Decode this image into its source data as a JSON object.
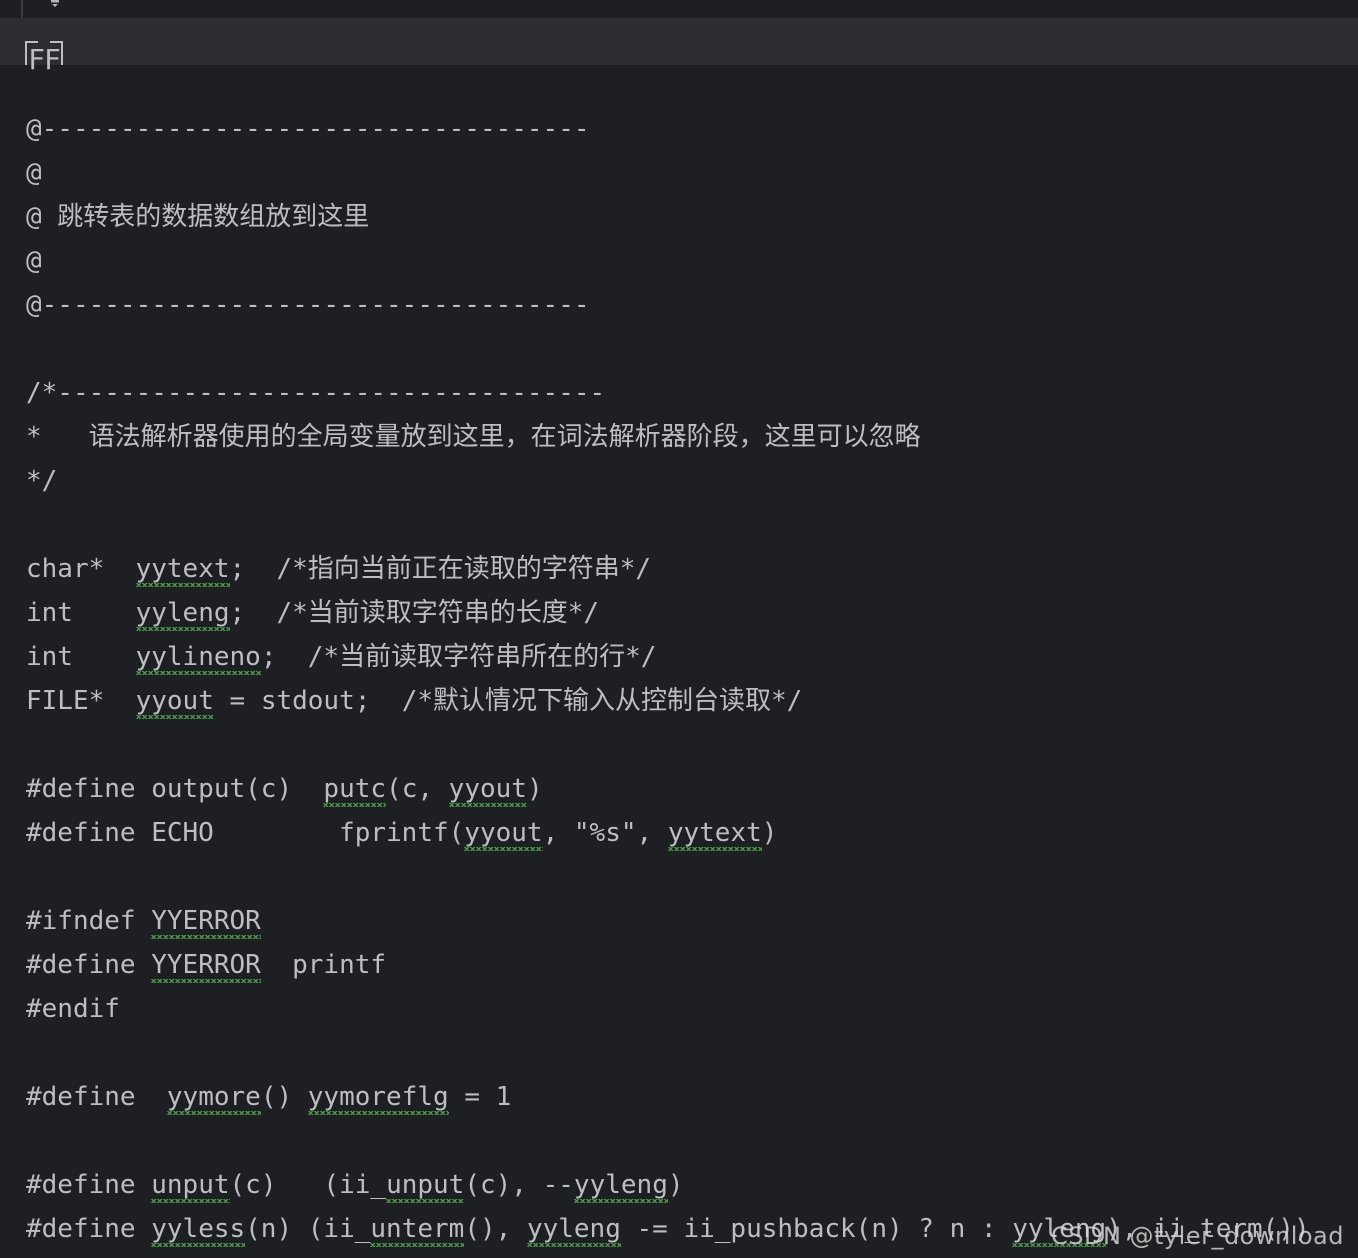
{
  "editor": {
    "background_color": "#1e1f22",
    "caret_row_color": "#2b2d30",
    "text_color": "#bcbec4",
    "gutter_rule_color": "#393b40",
    "spellcheck_squiggle_color": "#4e9a4e"
  },
  "intention_bulb": {
    "icon": "lightbulb-icon"
  },
  "fold_badge": {
    "label": "FF"
  },
  "code": {
    "lines": [
      {
        "id": "l01",
        "text": "@-----------------------------------",
        "cjk": false
      },
      {
        "id": "l02",
        "text": "@",
        "cjk": false
      },
      {
        "id": "l03",
        "text": "@ 跳转表的数据数组放到这里",
        "cjk": true
      },
      {
        "id": "l04",
        "text": "@",
        "cjk": false
      },
      {
        "id": "l05",
        "text": "@-----------------------------------",
        "cjk": false
      },
      {
        "id": "l06",
        "text": "",
        "cjk": false
      },
      {
        "id": "l07",
        "text": "/*-----------------------------------",
        "cjk": false
      },
      {
        "id": "l08",
        "text": "*   语法解析器使用的全局变量放到这里，在词法解析器阶段，这里可以忽略",
        "cjk": true
      },
      {
        "id": "l09",
        "text": "*/",
        "cjk": false
      },
      {
        "id": "l10",
        "text": "",
        "cjk": false
      },
      {
        "id": "l11",
        "text": "char*  yytext;  /*指向当前正在读取的字符串*/",
        "cjk": true
      },
      {
        "id": "l12",
        "text": "int    yyleng;  /*当前读取字符串的长度*/",
        "cjk": true
      },
      {
        "id": "l13",
        "text": "int    yylineno;  /*当前读取字符串所在的行*/",
        "cjk": true
      },
      {
        "id": "l14",
        "text": "FILE*  yyout = stdout;  /*默认情况下输入从控制台读取*/",
        "cjk": true
      },
      {
        "id": "l15",
        "text": "",
        "cjk": false
      },
      {
        "id": "l16",
        "text": "#define output(c)  putc(c, yyout)",
        "cjk": false
      },
      {
        "id": "l17",
        "text": "#define ECHO        fprintf(yyout, \"%s\", yytext)",
        "cjk": false
      },
      {
        "id": "l18",
        "text": "",
        "cjk": false
      },
      {
        "id": "l19",
        "text": "#ifndef YYERROR",
        "cjk": false
      },
      {
        "id": "l20",
        "text": "#define YYERROR  printf",
        "cjk": false
      },
      {
        "id": "l21",
        "text": "#endif",
        "cjk": false
      },
      {
        "id": "l22",
        "text": "",
        "cjk": false
      },
      {
        "id": "l23",
        "text": "#define  yymore() yymoreflg = 1",
        "cjk": false
      },
      {
        "id": "l24",
        "text": "",
        "cjk": false
      },
      {
        "id": "l25",
        "text": "#define unput(c)   (ii_unput(c), --yyleng)",
        "cjk": false
      },
      {
        "id": "l26",
        "text": "#define yyless(n) (ii_unterm(), yyleng -= ii_pushback(n) ? n : yyleng), ii_term())",
        "cjk": false
      }
    ]
  },
  "watermark": {
    "text": "CSDN @tyler_download"
  }
}
